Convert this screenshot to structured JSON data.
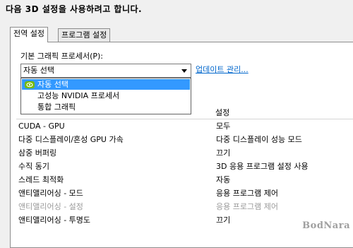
{
  "heading": "다음 3D 설정을 사용하려고 합니다.",
  "tabs": [
    {
      "label": "전역 설정",
      "active": true
    },
    {
      "label": "프로그램 설정",
      "active": false
    }
  ],
  "processor": {
    "label": "기본 그래픽 프로세서(P):",
    "selected": "자동 선택",
    "options": [
      "자동 선택",
      "고성능 NVIDIA 프로세서",
      "통합 그래픽"
    ],
    "highlight_color": "#3399ff",
    "icon": "nvidia-logo-icon"
  },
  "update_link": "업데이트 관리...",
  "table": {
    "header_value": "설정",
    "rows": [
      {
        "feature": "CUDA - GPU",
        "value": "모두",
        "enabled": true
      },
      {
        "feature": "다중 디스플레이/혼성 GPU 가속",
        "value": "다중 디스플레이 성능 모드",
        "enabled": true
      },
      {
        "feature": "삼중 버퍼링",
        "value": "끄기",
        "enabled": true
      },
      {
        "feature": "수직 동기",
        "value": "3D 응용 프로그램 설정 사용",
        "enabled": true
      },
      {
        "feature": "스레드 최적화",
        "value": "자동",
        "enabled": true
      },
      {
        "feature": "앤티앨리어싱 - 모드",
        "value": "응용 프로그램 제어",
        "enabled": true
      },
      {
        "feature": "앤티앨리어싱 - 설정",
        "value": "응용 프로그램 제어",
        "enabled": false
      },
      {
        "feature": "앤티앨리어싱 - 투명도",
        "value": "끄기",
        "enabled": true
      }
    ]
  },
  "watermark": "BodNara"
}
